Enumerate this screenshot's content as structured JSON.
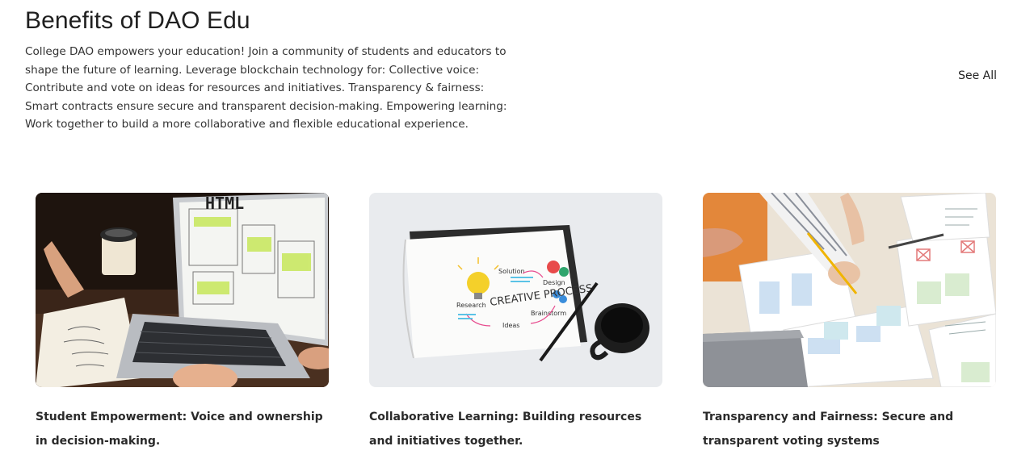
{
  "section": {
    "title": "Benefits of DAO Edu",
    "description": "College DAO empowers your education! Join a community of students and educators to shape the future of learning. Leverage blockchain technology for: Collective voice: Contribute and vote on ideas for resources and initiatives. Transparency & fairness: Smart contracts ensure secure and transparent decision-making. Empowering learning: Work together to build a more collaborative and flexible educational experience.",
    "see_all_label": "See All"
  },
  "cards": [
    {
      "caption": "Student Empowerment: Voice and ownership in decision-making.",
      "image_text": "HTML"
    },
    {
      "caption": "Collaborative Learning: Building resources and initiatives together.",
      "image_text": {
        "title": "CREATIVE PROCESS",
        "labels": [
          "Solution",
          "Design",
          "Brainstorm",
          "Ideas",
          "Research"
        ]
      }
    },
    {
      "caption": "Transparency and Fairness: Secure and transparent voting systems"
    }
  ]
}
